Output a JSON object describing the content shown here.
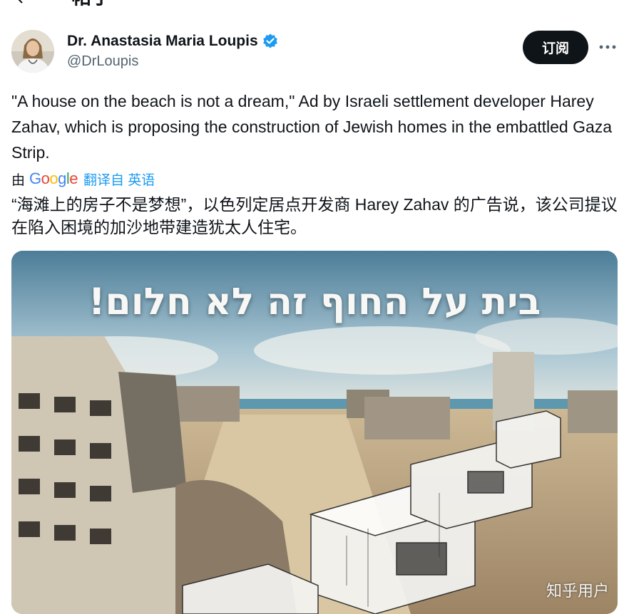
{
  "header": {
    "title": "帖子",
    "back_icon": "arrow-left-icon"
  },
  "tweet": {
    "author": {
      "display_name": "Dr. Anastasia Maria Loupis",
      "handle": "@DrLoupis",
      "verified_icon": "verified-badge-icon",
      "verified_color": "#1d9bf0"
    },
    "subscribe_label": "订阅",
    "more_icon": "more-horizontal-icon",
    "text": "\"A house on the beach is not a dream,\" Ad by Israeli settlement developer Harey Zahav, which is proposing the construction of Jewish homes in the embattled Gaza Strip.",
    "translation": {
      "by_label": "由",
      "provider": "Google",
      "link_label": "翻译自 英语",
      "text": "“海滩上的房子不是梦想”，以色列定居点开发商 Harey Zahav 的广告说，该公司提议在陷入困境的加沙地带建造犹太人住宅。"
    },
    "media": {
      "overlay_text": "בית על החוף זה לא חלום!",
      "watermark": "知乎用户"
    }
  },
  "colors": {
    "accent": "#1d9bf0",
    "text": "#0f1419",
    "secondary": "#536471",
    "button_bg": "#0f1419"
  }
}
